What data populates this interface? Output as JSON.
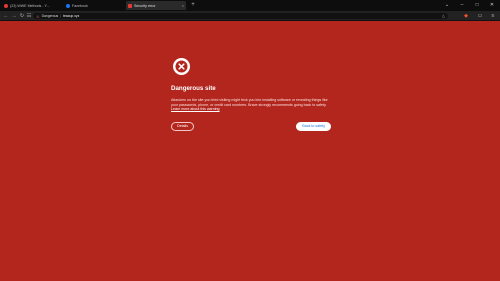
{
  "tabs": [
    {
      "title": "(23) WWE Methods - Y…",
      "active": false
    },
    {
      "title": "Facebook",
      "active": false
    },
    {
      "title": "Security error",
      "active": true
    }
  ],
  "new_tab_label": "+",
  "window_controls": {
    "chevron": "⌄",
    "minimize": "–",
    "maximize": "□",
    "close": "✕"
  },
  "toolbar": {
    "back": "←",
    "forward": "→",
    "reload": "↻",
    "bookmark": "☷",
    "warning_label": "Dangerous",
    "url": "teacup.xyz",
    "share": "△",
    "brave": "◆",
    "menu": "≡"
  },
  "page": {
    "heading": "Dangerous site",
    "message": "Attackers on the site you tried visiting might trick you into installing software or revealing things like your passwords, phone, or credit card numbers. Brave strongly recommends going back to safety.",
    "learn_more": "Learn more about this warning",
    "details_button": "Details",
    "back_button": "Back to safety"
  },
  "colors": {
    "page_bg": "#b3261e",
    "primary_button_text": "#1a73e8"
  }
}
